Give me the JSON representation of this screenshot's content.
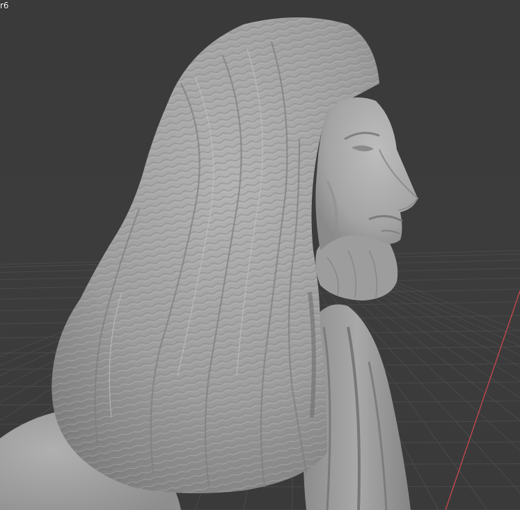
{
  "viewport": {
    "overlay_label": "r6",
    "background_color": "#3a3a3a",
    "grid_color": "#4a4a4a",
    "x_axis_color": "#c0484c",
    "model_color": "#a6a6a6",
    "model_name": "sculpted-bust-long-hair-beard"
  }
}
